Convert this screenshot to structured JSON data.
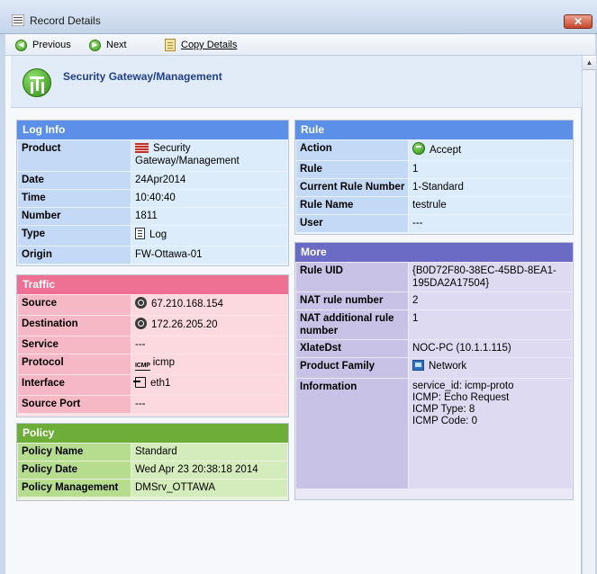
{
  "window": {
    "title": "Record Details",
    "close_label": "✕"
  },
  "toolbar": {
    "previous_label": "Previous",
    "next_label": "Next",
    "copy_label": "Copy Details"
  },
  "header": {
    "title": "Security Gateway/Management"
  },
  "log_info": {
    "title": "Log Info",
    "rows": [
      {
        "key": "Product",
        "value": "Security Gateway/Management",
        "icon": "firewall-icon"
      },
      {
        "key": "Date",
        "value": "24Apr2014"
      },
      {
        "key": "Time",
        "value": "10:40:40"
      },
      {
        "key": "Number",
        "value": "1811"
      },
      {
        "key": "Type",
        "value": "Log",
        "icon": "log-document-icon"
      },
      {
        "key": "Origin",
        "value": "FW-Ottawa-01"
      }
    ]
  },
  "traffic": {
    "title": "Traffic",
    "rows": [
      {
        "key": "Source",
        "value": "67.210.168.154",
        "icon": "network-host-icon"
      },
      {
        "key": "Destination",
        "value": "172.26.205.20",
        "icon": "network-host-icon"
      },
      {
        "key": "Service",
        "value": "---"
      },
      {
        "key": "Protocol",
        "value": "icmp",
        "icon": "icmp-icon",
        "icon_text": "ICMP"
      },
      {
        "key": "Interface",
        "value": "eth1",
        "icon": "interface-icon"
      },
      {
        "key": "Source Port",
        "value": "---"
      }
    ]
  },
  "policy": {
    "title": "Policy",
    "rows": [
      {
        "key": "Policy Name",
        "value": "Standard"
      },
      {
        "key": "Policy Date",
        "value": "Wed Apr 23 20:38:18 2014"
      },
      {
        "key": "Policy Management",
        "value": "DMSrv_OTTAWA"
      }
    ]
  },
  "rule": {
    "title": "Rule",
    "rows": [
      {
        "key": "Action",
        "value": "Accept",
        "icon": "accept-icon"
      },
      {
        "key": "Rule",
        "value": "1"
      },
      {
        "key": "Current Rule Number",
        "value": "1-Standard"
      },
      {
        "key": "Rule Name",
        "value": "testrule"
      },
      {
        "key": "User",
        "value": "---"
      }
    ]
  },
  "more": {
    "title": "More",
    "rows": [
      {
        "key": "Rule UID",
        "value": "{B0D72F80-38EC-45BD-8EA1-195DA2A17504}"
      },
      {
        "key": "NAT rule number",
        "value": "2"
      },
      {
        "key": "NAT additional rule number",
        "value": "1"
      },
      {
        "key": "XlateDst",
        "value": "NOC-PC (10.1.1.115)"
      },
      {
        "key": "Product Family",
        "value": "Network",
        "icon": "network-family-icon"
      },
      {
        "key": "Information",
        "value": "service_id: icmp-proto\nICMP: Echo Request\nICMP Type: 8\nICMP Code: 0"
      }
    ]
  },
  "colors": {
    "log_info": "#5b8fe8",
    "traffic": "#ee7193",
    "policy": "#6cae38",
    "rule": "#5b8fe8",
    "more": "#6b6bc6"
  }
}
